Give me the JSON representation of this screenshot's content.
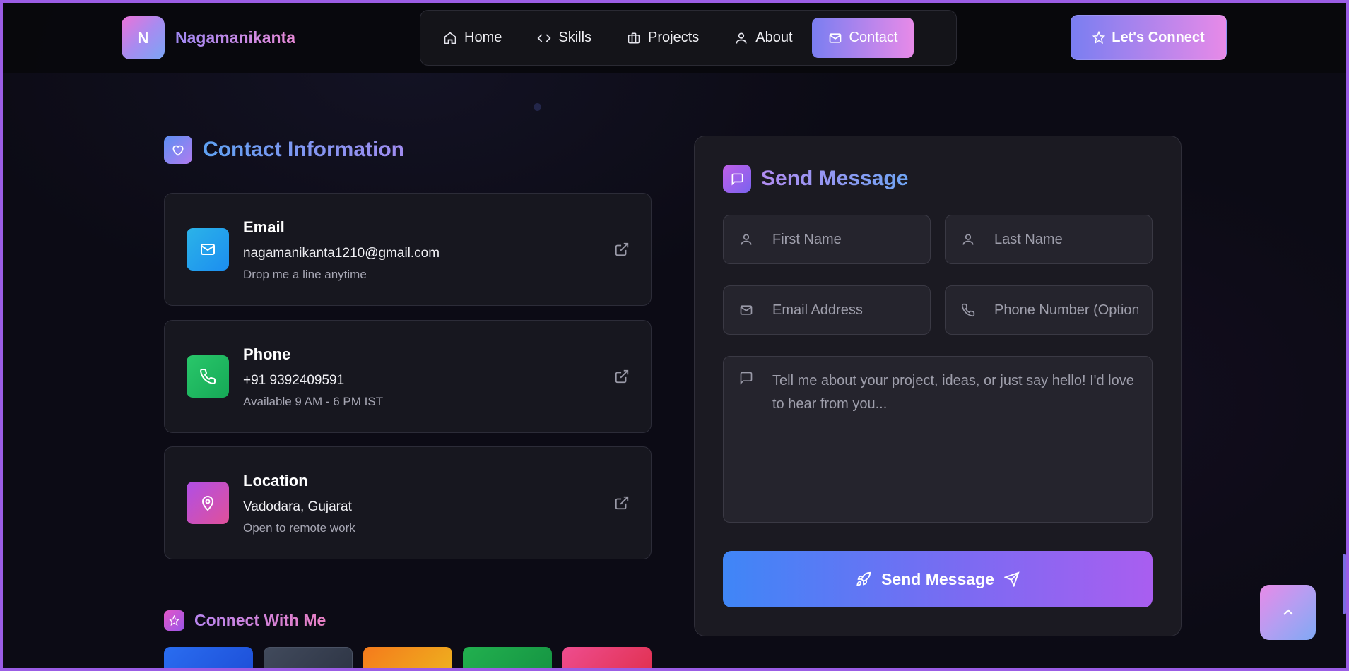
{
  "brand": {
    "initial": "N",
    "name": "Nagamanikanta"
  },
  "nav": {
    "items": [
      {
        "label": "Home",
        "icon": "home-icon"
      },
      {
        "label": "Skills",
        "icon": "code-icon"
      },
      {
        "label": "Projects",
        "icon": "briefcase-icon"
      },
      {
        "label": "About",
        "icon": "user-icon"
      },
      {
        "label": "Contact",
        "icon": "mail-icon",
        "active": true
      }
    ],
    "cta_label": "Let's Connect"
  },
  "contact_info": {
    "title": "Contact Information",
    "cards": [
      {
        "title": "Email",
        "value": "nagamanikanta1210@gmail.com",
        "sub": "Drop me a line anytime",
        "color": "#1ea7e6"
      },
      {
        "title": "Phone",
        "value": "+91 9392409591",
        "sub": "Available 9 AM - 6 PM IST",
        "color": "#22c063"
      },
      {
        "title": "Location",
        "value": "Vadodara, Gujarat",
        "sub": "Open to remote work",
        "color": "#c054e0"
      }
    ]
  },
  "connect": {
    "title": "Connect With Me",
    "tile_colors": [
      "#2562e8",
      "#3c4456",
      "#f38b1c",
      "#1fa34c",
      "#e7437a"
    ]
  },
  "form": {
    "title": "Send Message",
    "first_name_placeholder": "First Name",
    "last_name_placeholder": "Last Name",
    "email_placeholder": "Email Address",
    "phone_placeholder": "Phone Number (Optional)",
    "message_placeholder": "Tell me about your project, ideas, or just say hello! I'd love to hear from you...",
    "submit_label": "Send Message"
  },
  "colors": {
    "accent_start": "#7a7ef1",
    "accent_end": "#e78ae8",
    "frame": "#9b5de5",
    "background": "#0c0b15"
  }
}
